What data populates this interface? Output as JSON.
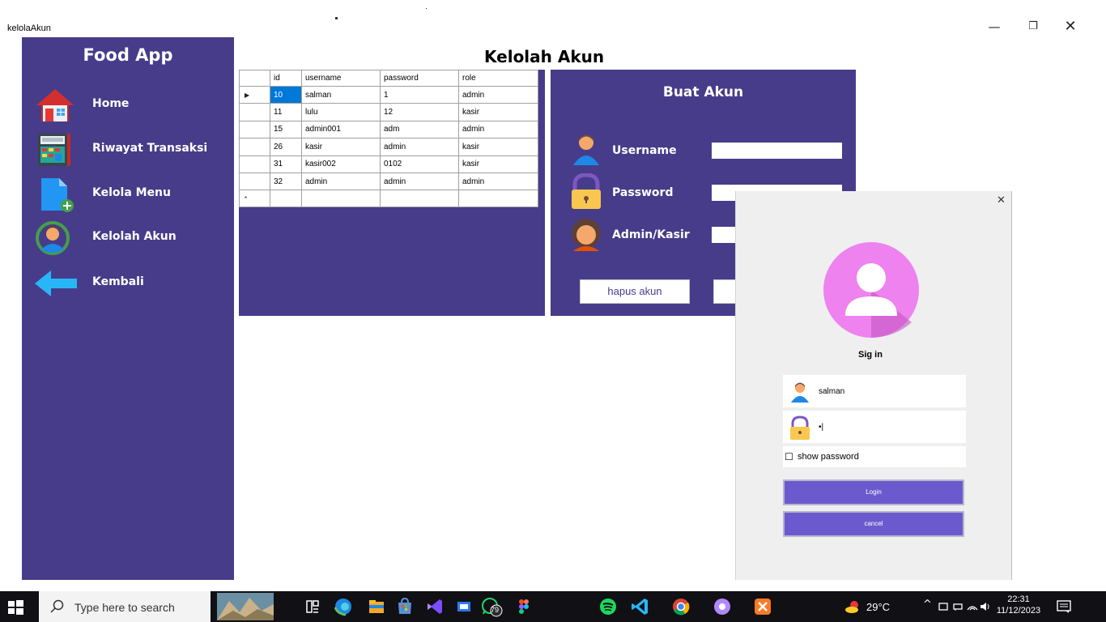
{
  "window": {
    "title": "kelolaAkun",
    "min": "—",
    "max": "❐",
    "close": "✕"
  },
  "sidebar": {
    "brand": "Food App",
    "items": [
      {
        "label": "Home",
        "icon": "home-icon"
      },
      {
        "label": "Riwayat Transaksi",
        "icon": "cash-register-icon"
      },
      {
        "label": "Kelola Menu",
        "icon": "add-file-icon"
      },
      {
        "label": "Kelolah Akun",
        "icon": "user-sync-icon"
      },
      {
        "label": "Kembali",
        "icon": "back-arrow-icon"
      }
    ]
  },
  "page_title": "Kelolah Akun",
  "grid": {
    "columns": [
      "id",
      "username",
      "password",
      "role"
    ],
    "rows": [
      {
        "id": "10",
        "username": "salman",
        "password": "1",
        "role": "admin",
        "selected": true
      },
      {
        "id": "11",
        "username": "lulu",
        "password": "12",
        "role": "kasir"
      },
      {
        "id": "15",
        "username": "admin001",
        "password": "adm",
        "role": "admin"
      },
      {
        "id": "26",
        "username": "kasir",
        "password": "admin",
        "role": "kasir"
      },
      {
        "id": "31",
        "username": "kasir002",
        "password": "0102",
        "role": "kasir"
      },
      {
        "id": "32",
        "username": "admin",
        "password": "admin",
        "role": "admin"
      }
    ],
    "current_marker": "▶",
    "new_row_marker": "*"
  },
  "create_account": {
    "title": "Buat Akun",
    "username_label": "Username",
    "password_label": "Password",
    "role_label": "Admin/Kasir",
    "delete_button": "hapus akun"
  },
  "login_dialog": {
    "close": "✕",
    "title": "Sig in",
    "username_value": "salman",
    "password_value": "•|",
    "show_password_label": "show password",
    "checkbox": "☐",
    "login_button": "Login",
    "cancel_button": "cancel"
  },
  "taskbar": {
    "search_placeholder": "Type here to search",
    "weather": "29°C",
    "time": "22:31",
    "date": "11/12/2023",
    "whatsapp_badge": "79",
    "tray_chevron": "^"
  },
  "colors": {
    "sidebar": "#473c8a",
    "accent_button": "#6a5acd",
    "selection": "#0078d7",
    "avatar": "#ee82ee"
  }
}
